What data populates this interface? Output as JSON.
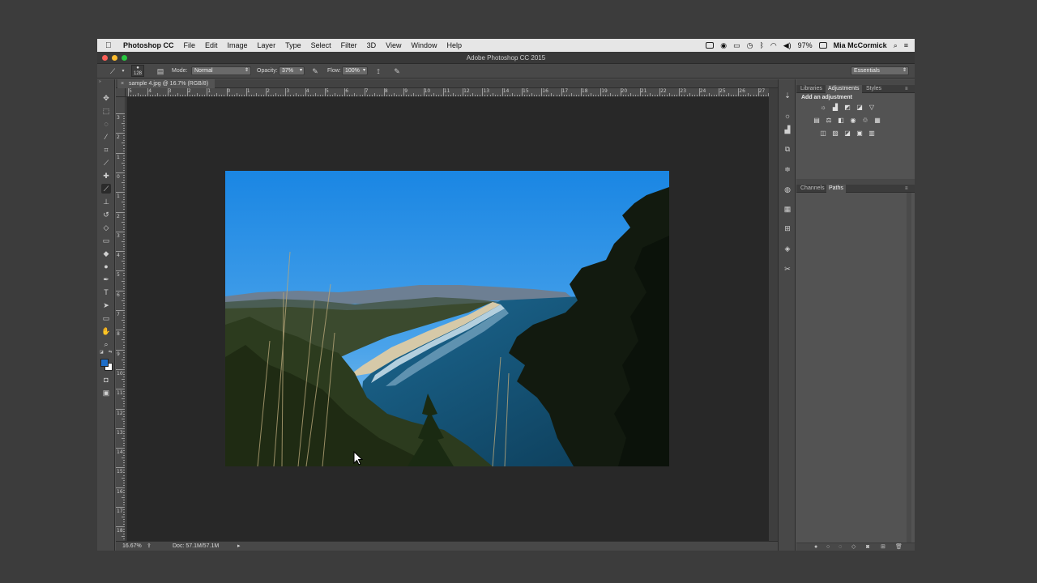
{
  "menubar": {
    "app_name": "Photoshop CC",
    "items": [
      "File",
      "Edit",
      "Image",
      "Layer",
      "Type",
      "Select",
      "Filter",
      "3D",
      "View",
      "Window",
      "Help"
    ],
    "battery": "97%",
    "user": "Mia McCormick"
  },
  "window": {
    "title": "Adobe Photoshop CC 2015",
    "traffic_colors": [
      "#fc5f57",
      "#fdbc2e",
      "#28c840"
    ]
  },
  "options": {
    "brush_size": "128",
    "mode_label": "Mode:",
    "mode_value": "Normal",
    "opacity_label": "Opacity:",
    "opacity_value": "37%",
    "flow_label": "Flow:",
    "flow_value": "100%",
    "workspace": "Essentials"
  },
  "document": {
    "tab_title": "sample 4.jpg @ 16.7% (RGB/8)",
    "zoom": "16.67%",
    "doc_info": "Doc: 57.1M/57.1M"
  },
  "rulers": {
    "h_labels": [
      "5",
      "4",
      "3",
      "2",
      "1",
      "0",
      "1",
      "2",
      "3",
      "4",
      "5",
      "6",
      "7",
      "8",
      "9",
      "10",
      "11",
      "12",
      "13",
      "14",
      "15",
      "16",
      "17",
      "18",
      "19",
      "20",
      "21",
      "22",
      "23",
      "24",
      "25",
      "26",
      "27"
    ],
    "v_labels": [
      "3",
      "2",
      "1",
      "0",
      "1",
      "2",
      "3",
      "4",
      "5",
      "6",
      "7",
      "8",
      "9",
      "10",
      "11",
      "12",
      "13",
      "14",
      "15",
      "16",
      "17",
      "18"
    ]
  },
  "panels": {
    "top_tabs": [
      "Libraries",
      "Adjustments",
      "Styles"
    ],
    "active_top_tab": "Adjustments",
    "adjust_heading": "Add an adjustment",
    "bottom_tabs": [
      "Channels",
      "Paths"
    ],
    "active_bottom_tab": "Paths"
  },
  "tools": [
    "move-tool",
    "marquee-tool",
    "lasso-tool",
    "quick-select-tool",
    "crop-tool",
    "eyedropper-tool",
    "spot-heal-tool",
    "brush-tool",
    "clone-stamp-tool",
    "history-brush-tool",
    "eraser-tool",
    "gradient-tool",
    "blur-tool",
    "dodge-tool",
    "pen-tool",
    "type-tool",
    "path-select-tool",
    "rectangle-tool",
    "hand-tool",
    "zoom-tool"
  ],
  "colors": {
    "foreground": "#1f6fc9",
    "background": "#ffffff"
  }
}
